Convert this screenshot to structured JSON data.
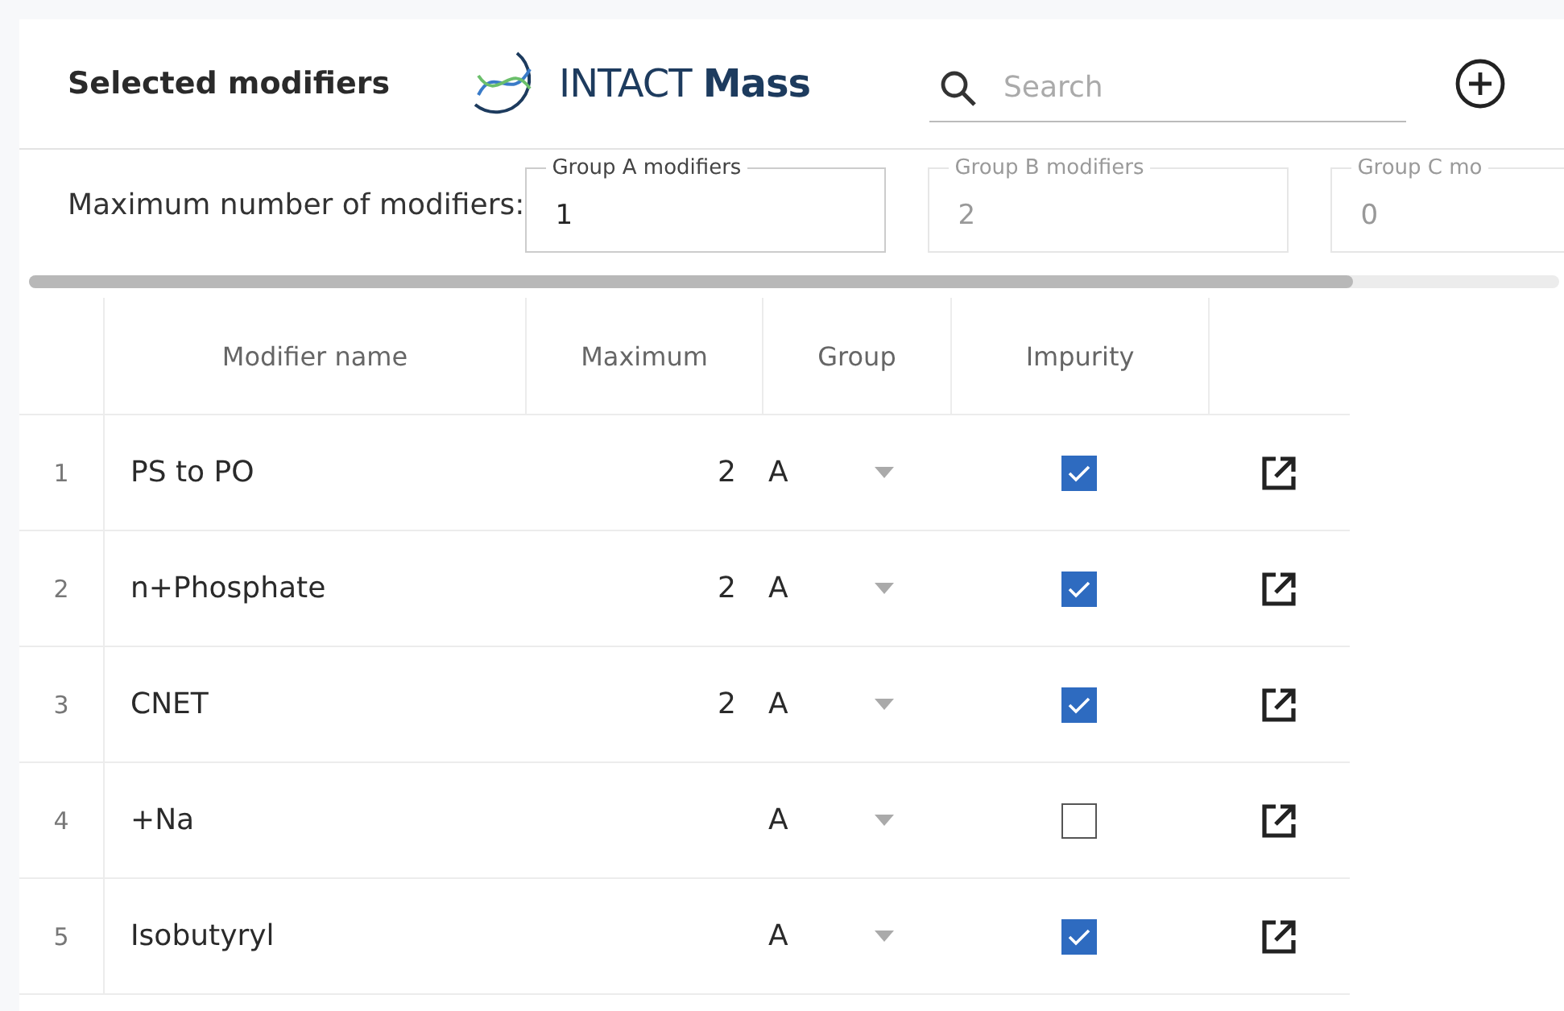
{
  "header": {
    "title": "Selected modifiers",
    "logo": {
      "light": "INTACT",
      "bold": "Mass"
    },
    "search": {
      "placeholder": "Search"
    }
  },
  "limits": {
    "label": "Maximum number of modifiers:",
    "fields": [
      {
        "label": "Group A modifiers",
        "value": "1",
        "disabled": false
      },
      {
        "label": "Group B modifiers",
        "value": "2",
        "disabled": true
      },
      {
        "label": "Group C mo",
        "value": "0",
        "disabled": true
      }
    ]
  },
  "table": {
    "columns": [
      "Modifier name",
      "Maximum",
      "Group",
      "Impurity"
    ],
    "rows": [
      {
        "index": "1",
        "name": "PS to PO",
        "maximum": "2",
        "group": "A",
        "impurity": true
      },
      {
        "index": "2",
        "name": "n+Phosphate",
        "maximum": "2",
        "group": "A",
        "impurity": true
      },
      {
        "index": "3",
        "name": "CNET",
        "maximum": "2",
        "group": "A",
        "impurity": true
      },
      {
        "index": "4",
        "name": "+Na",
        "group": "A",
        "impurity": false
      },
      {
        "index": "5",
        "name": "Isobutyryl",
        "group": "A",
        "impurity": true
      }
    ]
  }
}
